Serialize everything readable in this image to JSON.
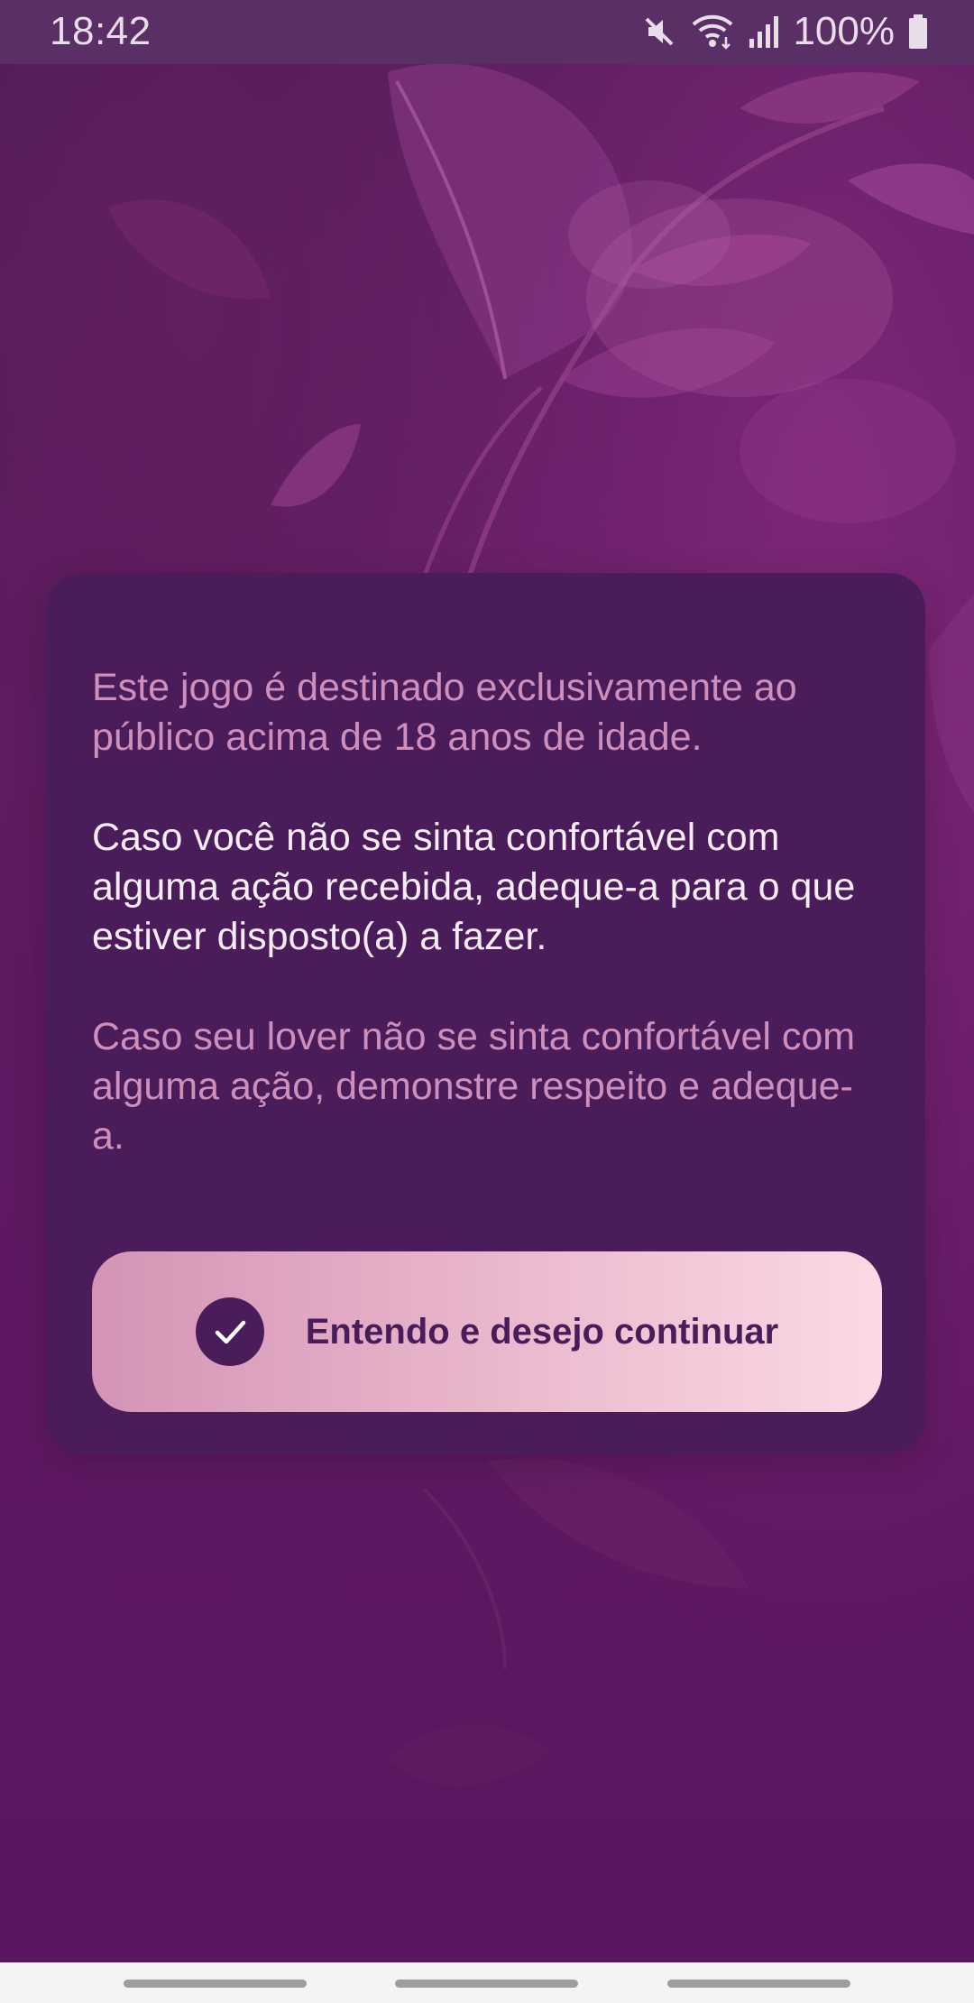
{
  "status_bar": {
    "time": "18:42",
    "battery": "100%",
    "icons": [
      "mute-icon",
      "wifi-icon",
      "signal-icon",
      "battery-icon"
    ]
  },
  "notice": {
    "paragraph_1": "Este jogo é destinado exclusivamente ao público acima de 18 anos de idade.",
    "paragraph_2": "Caso você não se sinta confortável com alguma ação recebida, adeque-a para o que estiver disposto(a) a fazer.",
    "paragraph_3": "Caso seu lover não se sinta confortável com alguma ação, demonstre respeito e adeque-a.",
    "button_label": "Entendo e desejo continuar",
    "button_icon": "check-icon"
  },
  "colors": {
    "background": "#5a1a60",
    "card": "#4a1d5a",
    "text_muted": "#cf8fbd",
    "text_primary": "#f6ecf4",
    "button_start": "#d394b5",
    "button_end": "#fbd9e4"
  },
  "nav_bar": {
    "items": [
      "recents-pill",
      "home-pill",
      "back-pill"
    ]
  }
}
